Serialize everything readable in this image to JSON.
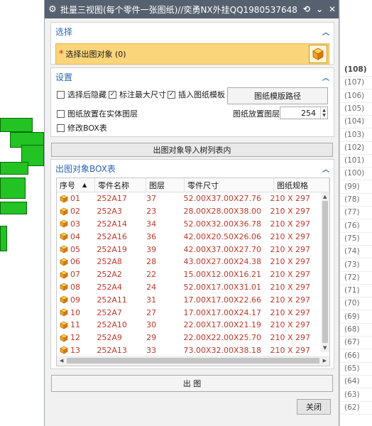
{
  "title": "批量三视图(每个零件一张图纸)//奕勇NX外挂QQ1980537648",
  "selection": {
    "header": "选择",
    "label": "选择出图对象 (0)"
  },
  "settings": {
    "header": "设置",
    "hide_after_select": "选择后隐藏",
    "mark_max_size": "标注最大尺寸",
    "insert_template": "插入图纸模板",
    "template_path_button": "图纸模版路径",
    "place_in_solid_layer": "图纸放置在实体图层",
    "layer_label": "图纸放置图层",
    "layer_value": "254",
    "modify_box": "修改BOX表"
  },
  "import_button": "出图对象导入树列表内",
  "table": {
    "header": "出图对象BOX表",
    "columns": [
      "序号",
      "零件名称",
      "图层",
      "零件尺寸",
      "图纸规格"
    ],
    "rows": [
      [
        "01",
        "252A17",
        "37",
        "52.00X37.00X27.76",
        "210 X 297"
      ],
      [
        "02",
        "252A3",
        "23",
        "28.00X28.00X38.00",
        "210 X 297"
      ],
      [
        "03",
        "252A14",
        "34",
        "52.00X32.00X36.78",
        "210 X 297"
      ],
      [
        "04",
        "252A16",
        "36",
        "42.00X20.50X26.06",
        "210 X 297"
      ],
      [
        "05",
        "252A19",
        "39",
        "42.00X37.00X27.70",
        "210 X 297"
      ],
      [
        "06",
        "252A8",
        "28",
        "43.00X27.00X24.38",
        "210 X 297"
      ],
      [
        "07",
        "252A2",
        "22",
        "15.00X12.00X16.21",
        "210 X 297"
      ],
      [
        "08",
        "252A4",
        "24",
        "52.00X17.00X31.01",
        "210 X 297"
      ],
      [
        "09",
        "252A11",
        "31",
        "17.00X17.00X22.66",
        "210 X 297"
      ],
      [
        "10",
        "252A7",
        "27",
        "17.00X17.00X24.17",
        "210 X 297"
      ],
      [
        "11",
        "252A10",
        "30",
        "22.00X17.00X21.19",
        "210 X 297"
      ],
      [
        "12",
        "252A9",
        "29",
        "22.00X22.00X25.70",
        "210 X 297"
      ],
      [
        "13",
        "252A13",
        "33",
        "73.00X32.00X38.18",
        "210 X 297"
      ]
    ]
  },
  "output_button": "出 图",
  "close_button": "关闭",
  "background_list": [
    "(108)",
    "(107)",
    "(106)",
    "(105)",
    "(104)",
    "(103)",
    "(102)",
    "(101)",
    "(100)",
    "(99)",
    "(78)",
    "(77)",
    "(76)",
    "(75)",
    "(74)",
    "(73)",
    "(72)",
    "(71)",
    "(70)",
    "(69)",
    "(68)",
    "(67)",
    "(66)",
    "(65)",
    "(64)",
    "(63)",
    "(62)"
  ],
  "colors": {
    "title_bar": "#56616f",
    "section_header": "#2b64b3",
    "selection_bg": "#fbd57a",
    "table_text": "#c0392b",
    "model_green": "#22c322"
  }
}
